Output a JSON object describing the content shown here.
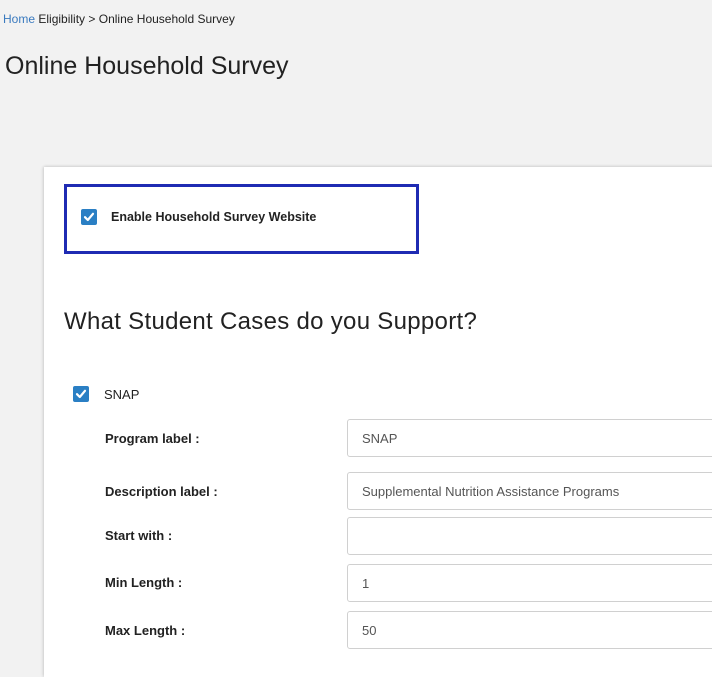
{
  "breadcrumb": {
    "home": "Home",
    "section": "Eligibility",
    "separator": ">",
    "current": "Online Household Survey"
  },
  "page": {
    "title": "Online Household Survey"
  },
  "enable_survey": {
    "checked": true,
    "label": "Enable Household Survey Website"
  },
  "student_cases": {
    "heading": "What Student Cases do you Support?",
    "snap": {
      "checked": true,
      "label": "SNAP",
      "fields": [
        {
          "label": "Program label :",
          "value": "SNAP"
        },
        {
          "label": "Description label :",
          "value": "Supplemental Nutrition Assistance Programs"
        },
        {
          "label": "Start with :",
          "value": ""
        },
        {
          "label": "Min Length :",
          "value": "1"
        },
        {
          "label": "Max Length :",
          "value": "50"
        }
      ]
    }
  },
  "colors": {
    "checkbox": "#2a7fc4",
    "highlight_border": "#1f2bb3",
    "link": "#3a7abf"
  }
}
